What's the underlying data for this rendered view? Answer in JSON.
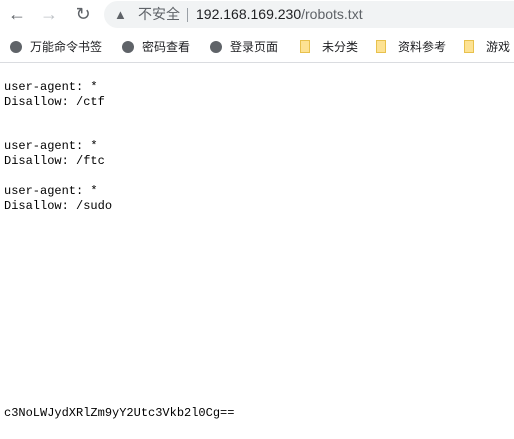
{
  "browser": {
    "back": "←",
    "forward": "→",
    "reload": "↻",
    "security_label": "不安全",
    "url_host": "192.168.169.230",
    "url_path": "/robots.txt"
  },
  "bookmarks": [
    {
      "label": "万能命令书签",
      "icon": "globe-icon"
    },
    {
      "label": "密码查看",
      "icon": "globe-icon"
    },
    {
      "label": "登录页面",
      "icon": "globe-icon"
    },
    {
      "label": "未分类",
      "icon": "folder-icon"
    },
    {
      "label": "资料参考",
      "icon": "folder-icon"
    },
    {
      "label": "游戏",
      "icon": "folder-icon"
    }
  ],
  "content": {
    "blocks": [
      "user-agent: *\nDisallow: /ctf",
      "user-agent: *\nDisallow: /ftc",
      "user-agent: *\nDisallow: /sudo"
    ],
    "footer": "c3NoLWJydXRlZm9yY2Utc3Vkb2l0Cg=="
  }
}
